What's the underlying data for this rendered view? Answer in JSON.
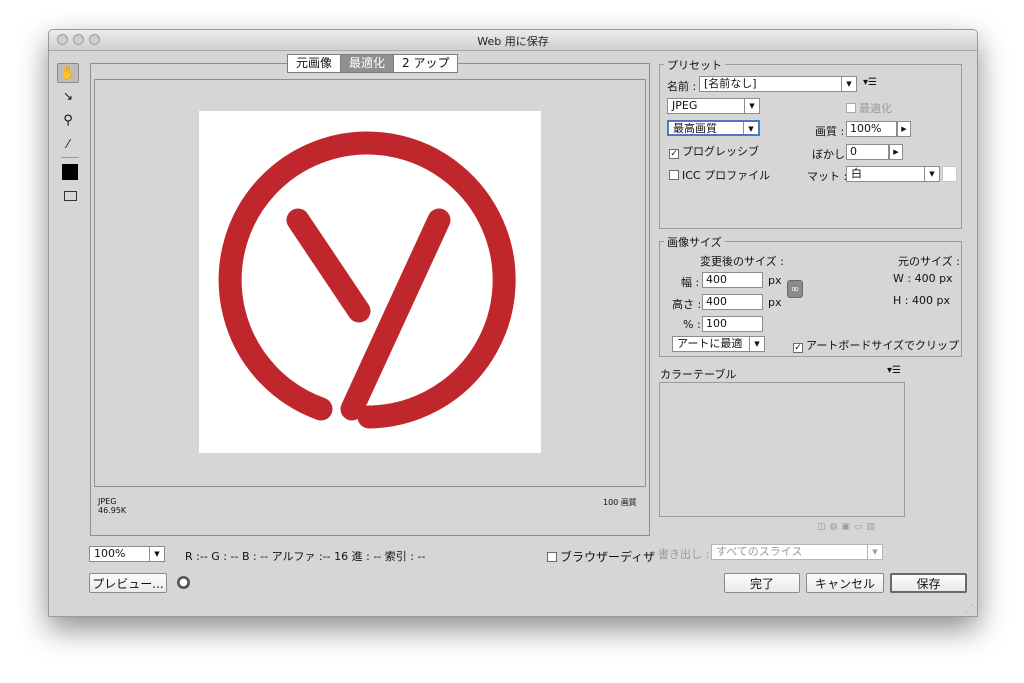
{
  "window": {
    "title": "Web 用に保存"
  },
  "view_tabs": [
    "元画像",
    "最適化",
    "2 アップ"
  ],
  "preview": {
    "format": "JPEG",
    "size": "46.95K",
    "quality_info": "100 画質"
  },
  "status_bar": {
    "zoom": "100%",
    "color_readout": "R :-- G : -- B : -- アルファ :-- 16 進 : -- 索引 : --",
    "browser_dither": "ブラウザーディザ"
  },
  "bottom": {
    "preview_button": "プレビュー...",
    "export_label": "書き出し :",
    "export_value": "すべてのスライス",
    "done_button": "完了",
    "cancel_button": "キャンセル",
    "save_button": "保存"
  },
  "preset": {
    "legend": "プリセット",
    "name_label": "名前 :",
    "name_value": "[名前なし]",
    "format": "JPEG",
    "optimize_label": "最適化",
    "quality_preset": "最高画質",
    "quality_label": "画質 :",
    "quality_value": "100%",
    "progressive_label": "プログレッシブ",
    "blur_label": "ぼかし :",
    "blur_value": "0",
    "icc_label": "ICC プロファイル",
    "matte_label": "マット :",
    "matte_value": "白"
  },
  "image_size": {
    "legend": "画像サイズ",
    "new_size_label": "変更後のサイズ :",
    "orig_size_label": "元のサイズ :",
    "width_label": "幅 :",
    "width_value": "400",
    "height_label": "高さ :",
    "height_value": "400",
    "unit": "px",
    "percent_label": "% :",
    "percent_value": "100",
    "orig_w": "W : 400 px",
    "orig_h": "H : 400 px",
    "fit_select": "アートに最適",
    "clip_label": "アートボードサイズでクリップ"
  },
  "color_table": {
    "title": "カラーテーブル"
  },
  "colors": {
    "logo_red": "#c0272d"
  }
}
